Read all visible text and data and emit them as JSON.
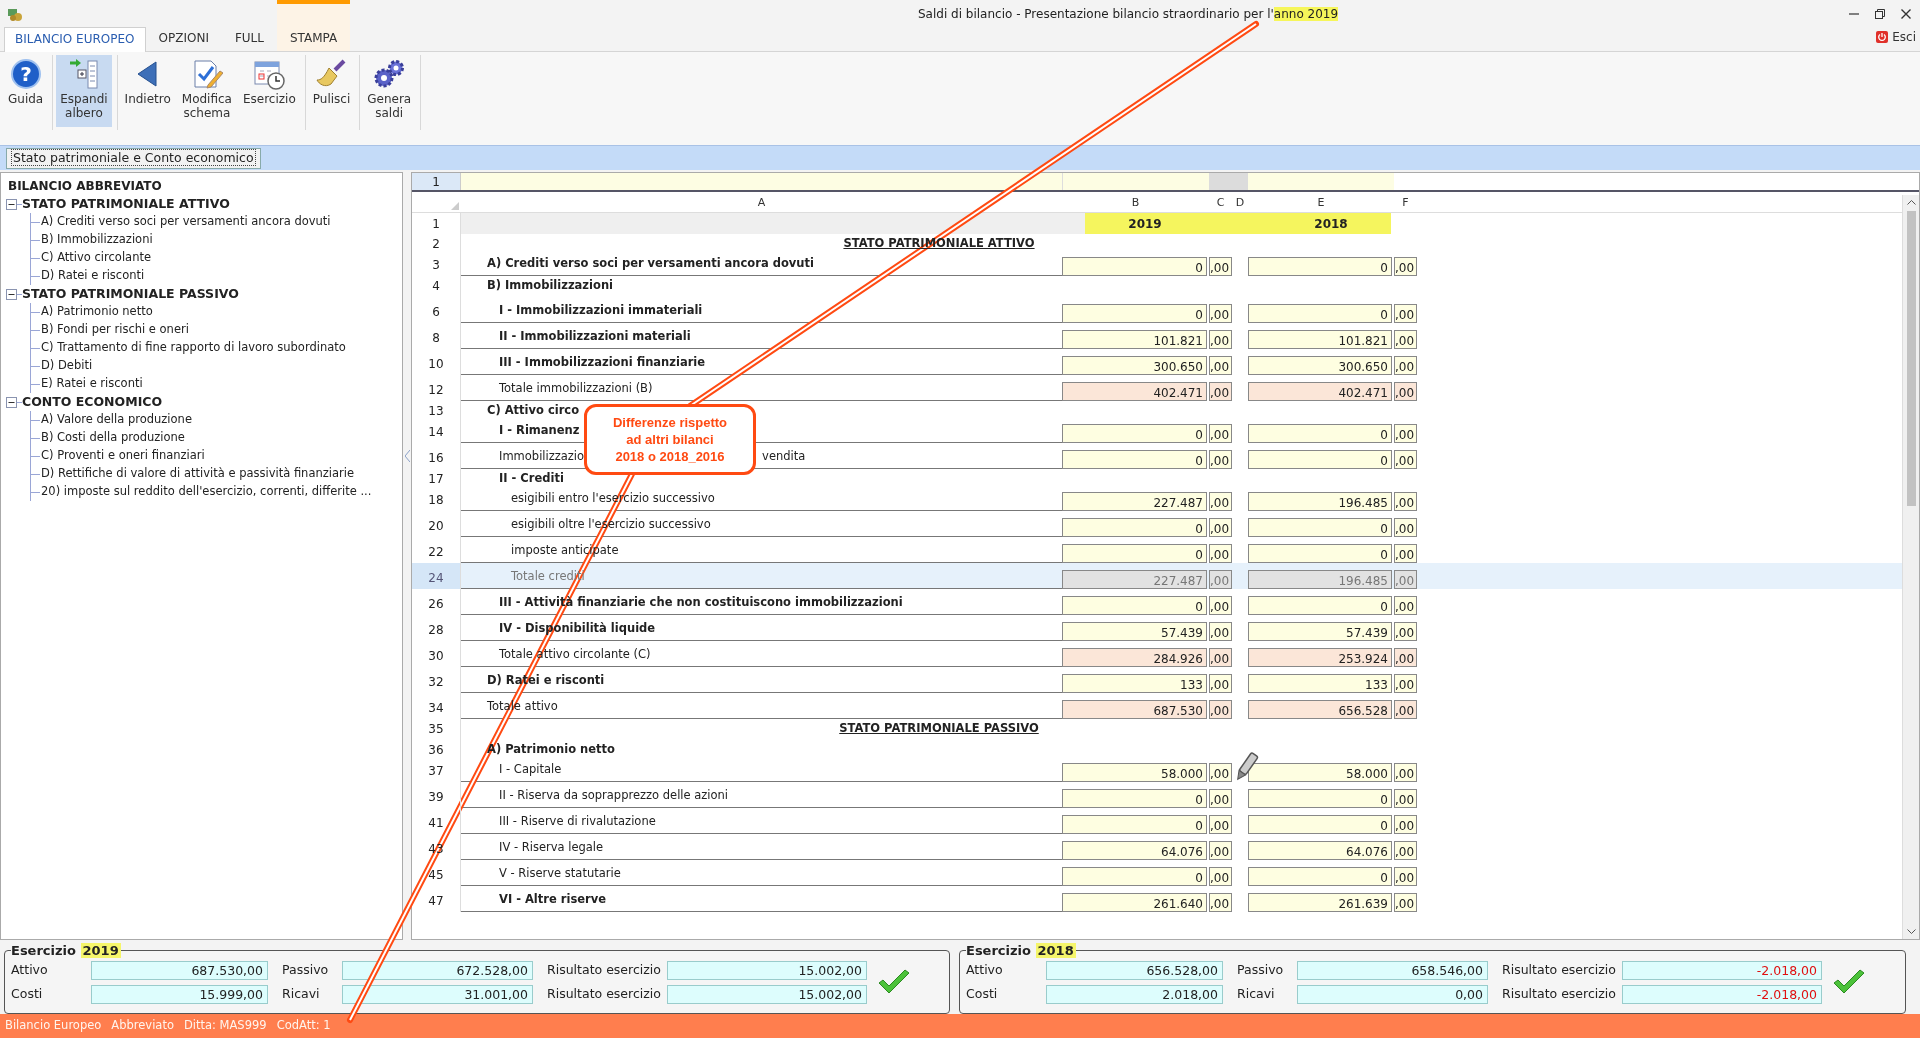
{
  "window": {
    "title": "Saldi di bilancio - Presentazione bilancio straordinario per l'",
    "title_highlight": "anno 2019"
  },
  "ribbon_tabs": [
    {
      "label": "BILANCIO EUROPEO",
      "selected": true,
      "contextual": false
    },
    {
      "label": "OPZIONI",
      "selected": false,
      "contextual": false
    },
    {
      "label": "FULL",
      "selected": false,
      "contextual": false
    },
    {
      "label": "STAMPA",
      "selected": false,
      "contextual": true
    }
  ],
  "exit_button": {
    "label": "Esci"
  },
  "ribbon_groups": [
    [
      {
        "label": "Guida",
        "kind": "help",
        "glyph": "?",
        "selected": false
      }
    ],
    [
      {
        "label": "Espandi albero",
        "kind": "expand",
        "selected": true
      }
    ],
    [
      {
        "label": "Indietro",
        "kind": "back",
        "selected": false
      },
      {
        "label": "Modifica schema",
        "kind": "edit",
        "selected": false
      },
      {
        "label": "Esercizio",
        "kind": "calendar",
        "selected": false
      }
    ],
    [
      {
        "label": "Pulisci",
        "kind": "broom",
        "selected": false
      }
    ],
    [
      {
        "label": "Genera saldi",
        "kind": "gears",
        "selected": false
      }
    ]
  ],
  "document_tabs": [
    {
      "label": "Stato patrimoniale e Conto economico",
      "selected": true
    }
  ],
  "tree": {
    "root": "BILANCIO ABBREVIATO",
    "nodes": [
      {
        "label": "STATO PATRIMONIALE ATTIVO",
        "expanded": true,
        "children": [
          {
            "label": "A) Crediti verso soci per versamenti ancora dovuti"
          },
          {
            "label": "B) Immobilizzazioni"
          },
          {
            "label": "C) Attivo circolante"
          },
          {
            "label": "D) Ratei e risconti"
          }
        ]
      },
      {
        "label": "STATO PATRIMONIALE PASSIVO",
        "expanded": true,
        "children": [
          {
            "label": "A) Patrimonio netto"
          },
          {
            "label": "B) Fondi per rischi e oneri"
          },
          {
            "label": "C) Trattamento di fine rapporto di lavoro subordinato"
          },
          {
            "label": "D) Debiti"
          },
          {
            "label": "E) Ratei e risconti"
          }
        ]
      },
      {
        "label": "CONTO ECONOMICO",
        "expanded": true,
        "children": [
          {
            "label": "A) Valore della produzione"
          },
          {
            "label": "B) Costi della produzione"
          },
          {
            "label": "C) Proventi e oneri finanziari"
          },
          {
            "label": "D) Rettifiche di valore di attività e passività finanziarie"
          },
          {
            "label": "20) imposte sul reddito dell'esercizio, correnti, differite ..."
          }
        ]
      }
    ]
  },
  "sheet": {
    "frozen_row": "1",
    "columns": [
      "A",
      "B",
      "C",
      "D",
      "E",
      "F"
    ],
    "year_row": {
      "number": "1",
      "years": [
        "2019",
        "2018"
      ]
    },
    "rows": [
      {
        "number": "2",
        "kind": "section",
        "label": "STATO PATRIMONIALE ATTIVO",
        "selected": false
      },
      {
        "number": "3",
        "kind": "group",
        "label": "A) Crediti verso soci per versamenti ancora dovuti",
        "selected": false,
        "total": false,
        "readonly": false,
        "b": "0",
        "c": ",00",
        "e": "0",
        "f": ",00"
      },
      {
        "number": "4",
        "kind": "group",
        "label": "B) Immobilizzazioni",
        "selected": false
      },
      {
        "number": "6",
        "kind": "subgroup",
        "label": "I - Immobilizzazioni immateriali",
        "selected": false,
        "total": false,
        "readonly": false,
        "b": "0",
        "c": ",00",
        "e": "0",
        "f": ",00"
      },
      {
        "number": "8",
        "kind": "subgroup",
        "label": "II - Immobilizzazioni materiali",
        "selected": false,
        "total": false,
        "readonly": false,
        "b": "101.821",
        "c": ",00",
        "e": "101.821",
        "f": ",00"
      },
      {
        "number": "10",
        "kind": "subgroup",
        "label": "III - Immobilizzazioni finanziarie",
        "selected": false,
        "total": false,
        "readonly": false,
        "b": "300.650",
        "c": ",00",
        "e": "300.650",
        "f": ",00"
      },
      {
        "number": "12",
        "kind": "item",
        "label": "Totale immobilizzazioni (B)",
        "selected": false,
        "total": true,
        "readonly": false,
        "b": "402.471",
        "c": ",00",
        "e": "402.471",
        "f": ",00"
      },
      {
        "number": "13",
        "kind": "group",
        "label": "C) Attivo circo",
        "selected": false
      },
      {
        "number": "14",
        "kind": "subgroup",
        "label": "I - Rimanenz",
        "selected": false,
        "total": false,
        "readonly": false,
        "b": "0",
        "c": ",00",
        "e": "0",
        "f": ",00"
      },
      {
        "number": "16",
        "kind": "item",
        "label": "Immobilizzazio",
        "label_end": "vendita",
        "selected": false,
        "total": false,
        "readonly": false,
        "b": "0",
        "c": ",00",
        "e": "0",
        "f": ",00"
      },
      {
        "number": "17",
        "kind": "subgroup",
        "label": "II - Crediti",
        "selected": false
      },
      {
        "number": "18",
        "kind": "subitem",
        "label": "esigibili entro l'esercizio successivo",
        "selected": false,
        "total": false,
        "readonly": false,
        "b": "227.487",
        "c": ",00",
        "e": "196.485",
        "f": ",00"
      },
      {
        "number": "20",
        "kind": "subitem",
        "label": "esigibili oltre l'esercizio successivo",
        "selected": false,
        "total": false,
        "readonly": false,
        "b": "0",
        "c": ",00",
        "e": "0",
        "f": ",00"
      },
      {
        "number": "22",
        "kind": "subitem",
        "label": "imposte anticipate",
        "selected": false,
        "total": false,
        "readonly": false,
        "b": "0",
        "c": ",00",
        "e": "0",
        "f": ",00"
      },
      {
        "number": "24",
        "kind": "subitem",
        "label": "Totale crediti",
        "selected": true,
        "readonly": true,
        "b": "227.487",
        "c": ",00",
        "e": "196.485",
        "f": ",00"
      },
      {
        "number": "26",
        "kind": "subgroup",
        "label": "III - Attività finanziarie che non costituiscono immobilizzazioni",
        "selected": false,
        "total": false,
        "readonly": false,
        "b": "0",
        "c": ",00",
        "e": "0",
        "f": ",00"
      },
      {
        "number": "28",
        "kind": "subgroup",
        "label": "IV - Disponibilità liquide",
        "selected": false,
        "total": false,
        "readonly": false,
        "b": "57.439",
        "c": ",00",
        "e": "57.439",
        "f": ",00"
      },
      {
        "number": "30",
        "kind": "item",
        "label": "Totale attivo circolante (C)",
        "selected": false,
        "total": true,
        "readonly": false,
        "b": "284.926",
        "c": ",00",
        "e": "253.924",
        "f": ",00"
      },
      {
        "number": "32",
        "kind": "group",
        "label": "D) Ratei e risconti",
        "selected": false,
        "total": false,
        "readonly": false,
        "b": "133",
        "c": ",00",
        "e": "133",
        "f": ",00"
      },
      {
        "number": "34",
        "kind": "total",
        "label": "Totale attivo",
        "selected": false,
        "total": true,
        "readonly": false,
        "b": "687.530",
        "c": ",00",
        "e": "656.528",
        "f": ",00"
      },
      {
        "number": "35",
        "kind": "section",
        "label": "STATO PATRIMONIALE PASSIVO",
        "selected": false
      },
      {
        "number": "36",
        "kind": "group",
        "label": "A) Patrimonio netto",
        "selected": false
      },
      {
        "number": "37",
        "kind": "item",
        "label": "I - Capitale",
        "selected": false,
        "total": false,
        "readonly": false,
        "b": "58.000",
        "c": ",00",
        "e": "58.000",
        "f": ",00"
      },
      {
        "number": "39",
        "kind": "item",
        "label": "II - Riserva da soprapprezzo delle azioni",
        "selected": false,
        "total": false,
        "readonly": false,
        "b": "0",
        "c": ",00",
        "e": "0",
        "f": ",00"
      },
      {
        "number": "41",
        "kind": "item",
        "label": "III - Riserve di rivalutazione",
        "selected": false,
        "total": false,
        "readonly": false,
        "b": "0",
        "c": ",00",
        "e": "0",
        "f": ",00"
      },
      {
        "number": "43",
        "kind": "item",
        "label": "IV - Riserva legale",
        "selected": false,
        "total": false,
        "readonly": false,
        "b": "64.076",
        "c": ",00",
        "e": "64.076",
        "f": ",00"
      },
      {
        "number": "45",
        "kind": "item",
        "label": "V - Riserve statutarie",
        "selected": false,
        "total": false,
        "readonly": false,
        "b": "0",
        "c": ",00",
        "e": "0",
        "f": ",00"
      },
      {
        "number": "47",
        "kind": "subgroup",
        "label": "VI - Altre riserve",
        "selected": false,
        "total": false,
        "readonly": false,
        "b": "261.640",
        "c": ",00",
        "e": "261.639",
        "f": ",00"
      }
    ]
  },
  "callout": {
    "text": "Differenze rispetto\nad altri bilanci\n2018 o 2018_2016"
  },
  "summaries": [
    {
      "label": "Esercizio",
      "year": "2019",
      "balanced": true,
      "fields": [
        {
          "label": "Attivo",
          "value": "687.530,00",
          "negative": false
        },
        {
          "label": "Passivo",
          "value": "672.528,00",
          "negative": false
        },
        {
          "label": "Risultato esercizio",
          "value": "15.002,00",
          "negative": false
        },
        {
          "label": "Costi",
          "value": "15.999,00",
          "negative": false
        },
        {
          "label": "Ricavi",
          "value": "31.001,00",
          "negative": false
        },
        {
          "label": "Risultato esercizio",
          "value": "15.002,00",
          "negative": false
        }
      ]
    },
    {
      "label": "Esercizio",
      "year": "2018",
      "balanced": true,
      "fields": [
        {
          "label": "Attivo",
          "value": "656.528,00",
          "negative": false
        },
        {
          "label": "Passivo",
          "value": "658.546,00",
          "negative": false
        },
        {
          "label": "Risultato esercizio",
          "value": "-2.018,00",
          "negative": true
        },
        {
          "label": "Costi",
          "value": "2.018,00",
          "negative": false
        },
        {
          "label": "Ricavi",
          "value": "0,00",
          "negative": false
        },
        {
          "label": "Risultato esercizio",
          "value": "-2.018,00",
          "negative": true
        }
      ]
    }
  ],
  "status_bar": [
    "Bilancio Europeo",
    "Abbreviato",
    "Ditta: MAS999",
    "CodAtt: 1"
  ]
}
